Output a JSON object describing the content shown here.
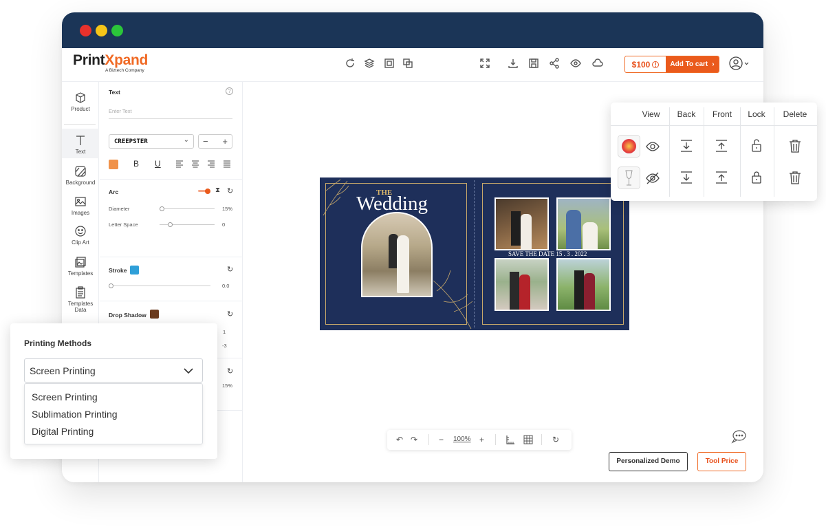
{
  "window": {
    "colors": {
      "titlebar": "#1b3557",
      "close": "#e8312c",
      "minimize": "#f5c518",
      "maximize": "#2bc53a",
      "accent": "#f06a25"
    }
  },
  "brand": {
    "name_a": "Print",
    "name_x": "X",
    "name_b": "pand",
    "tagline": "A Biztech Company"
  },
  "toolbar": {
    "icons": [
      "refresh-icon",
      "layers-icon",
      "duplicate-icon",
      "group-icon",
      "fullscreen-icon",
      "download-icon",
      "save-icon",
      "share-icon",
      "preview-icon",
      "cloud-icon"
    ],
    "price": "$100",
    "add_to_cart": "Add To cart"
  },
  "sidebar": {
    "items": [
      {
        "label": "Product",
        "icon": "cube-icon"
      },
      {
        "label": "Text",
        "icon": "text-icon"
      },
      {
        "label": "Background",
        "icon": "background-icon"
      },
      {
        "label": "Images",
        "icon": "image-icon"
      },
      {
        "label": "Clip Art",
        "icon": "smiley-icon"
      },
      {
        "label": "Templates",
        "icon": "templates-icon"
      },
      {
        "label": "Templates",
        "label2": "Data",
        "icon": "clipboard-icon"
      }
    ]
  },
  "panel": {
    "text_title": "Text",
    "text_placeholder": "Enter Text",
    "font_name": "CREEPSTER",
    "text_color": "#f0924a",
    "arc_title": "Arc",
    "diameter_label": "Diameter",
    "diameter_value": "15%",
    "letter_space_label": "Letter Space",
    "letter_space_value": "0",
    "stroke_title": "Stroke",
    "stroke_color": "#2f9fd8",
    "stroke_value": "0.0",
    "shadow_title": "Drop Shadow",
    "shadow_color": "#6b3a1d",
    "shadow_v1": "1",
    "shadow_v2": "-3",
    "opacity_value": "15%"
  },
  "design": {
    "title_small": "THE",
    "title_big": "Wedding",
    "save_date": "SAVE THE DATE 15 . 3 . 2022"
  },
  "layers": {
    "headers": [
      "View",
      "Back",
      "Front",
      "Lock",
      "Delete"
    ]
  },
  "printing": {
    "title": "Printing Methods",
    "selected": "Screen Printing",
    "options": [
      "Screen Printing",
      "Sublimation Printing",
      "Digital Printing"
    ]
  },
  "zoom": {
    "value": "100%"
  },
  "buttons": {
    "demo": "Personalized Demo",
    "tool_price": "Tool Price"
  }
}
